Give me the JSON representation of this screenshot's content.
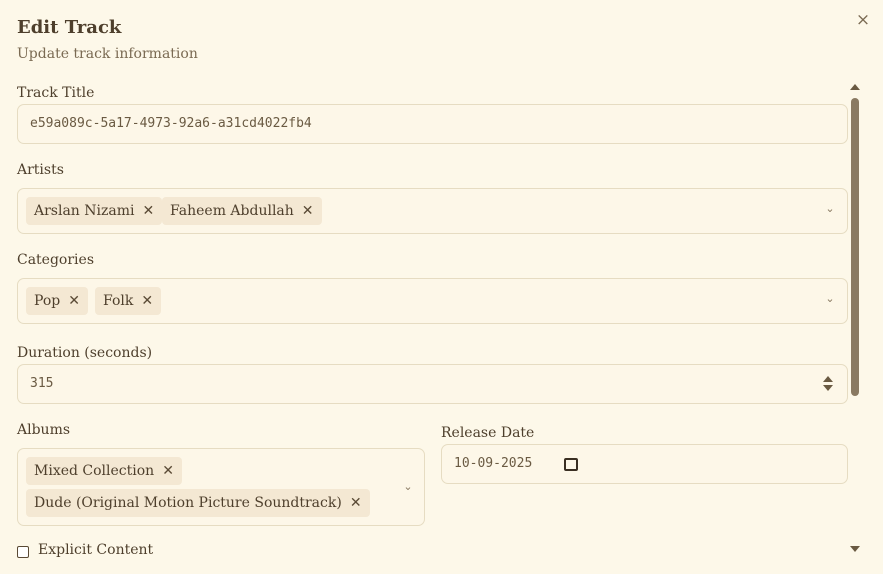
{
  "dialog": {
    "title": "Edit Track",
    "subtitle": "Update track information",
    "close_icon": "×"
  },
  "form": {
    "track_title": {
      "label": "Track Title",
      "value": "e59a089c-5a17-4973-92a6-a31cd4022fb4"
    },
    "artists": {
      "label": "Artists",
      "items": [
        "Arslan Nizami",
        "Faheem Abdullah"
      ]
    },
    "categories": {
      "label": "Categories",
      "items": [
        "Pop",
        "Folk"
      ]
    },
    "duration": {
      "label": "Duration (seconds)",
      "value": "315"
    },
    "albums": {
      "label": "Albums",
      "items": [
        "Mixed Collection",
        "Dude (Original Motion Picture Soundtrack)"
      ]
    },
    "release_date": {
      "label": "Release Date",
      "value": "10-09-2025"
    },
    "explicit": {
      "label": "Explicit Content",
      "checked": false
    }
  },
  "icons": {
    "remove": "✕",
    "chevron": "⌄"
  }
}
